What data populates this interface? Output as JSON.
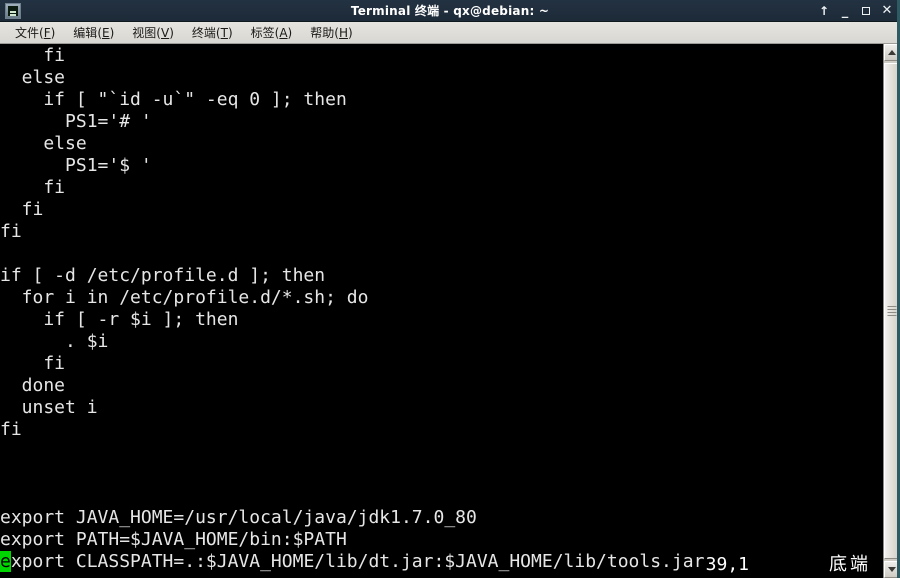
{
  "window": {
    "title": "Terminal 终端 - qx@debian: ~",
    "icon": "terminal-icon",
    "controls": [
      {
        "name": "shade-button",
        "glyph": "↑"
      },
      {
        "name": "minimize-button",
        "glyph": "_"
      },
      {
        "name": "maximize-button",
        "glyph": ""
      },
      {
        "name": "close-button",
        "glyph": "✕"
      }
    ]
  },
  "menubar": {
    "items": [
      {
        "name": "menu-file",
        "label": "文件",
        "accel": "F"
      },
      {
        "name": "menu-edit",
        "label": "编辑",
        "accel": "E"
      },
      {
        "name": "menu-view",
        "label": "视图",
        "accel": "V"
      },
      {
        "name": "menu-terminal",
        "label": "终端",
        "accel": "T"
      },
      {
        "name": "menu-tabs",
        "label": "标签",
        "accel": "A"
      },
      {
        "name": "menu-help",
        "label": "帮助",
        "accel": "H"
      }
    ]
  },
  "terminal": {
    "foreground": "#e6e6e6",
    "background": "#000000",
    "cursor_color": "#00d700",
    "lines": [
      "    fi",
      "  else",
      "    if [ \"`id -u`\" -eq 0 ]; then",
      "      PS1='# '",
      "    else",
      "      PS1='$ '",
      "    fi",
      "  fi",
      "fi",
      "",
      "if [ -d /etc/profile.d ]; then",
      "  for i in /etc/profile.d/*.sh; do",
      "    if [ -r $i ]; then",
      "      . $i",
      "    fi",
      "  done",
      "  unset i",
      "fi",
      "",
      "",
      ""
    ],
    "cursor_line": {
      "prefix": "",
      "cursor_char": "e",
      "suffix": "xport CLASSPATH=.:$JAVA_HOME/lib/dt.jar:$JAVA_HOME/lib/tools.jar"
    },
    "export_lines": [
      "export JAVA_HOME=/usr/local/java/jdk1.7.0_80",
      "export PATH=$JAVA_HOME/bin:$PATH"
    ],
    "status": {
      "position": "39,1",
      "state": "底端"
    }
  },
  "scrollbar": {
    "up_arrow": "scroll-up-arrow",
    "down_arrow": "scroll-down-arrow",
    "thumb": "scroll-thumb"
  }
}
